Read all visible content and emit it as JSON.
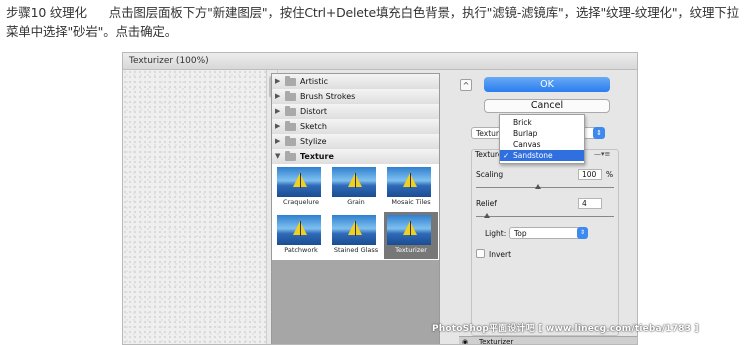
{
  "instruction": {
    "step": "步骤10 纹理化",
    "text": "点击图层面板下方\"新建图层\"，按住Ctrl+Delete填充白色背景，执行\"滤镜-滤镜库\"，选择\"纹理-纹理化\"，纹理下拉菜单中选择\"砂岩\"。点击确定。"
  },
  "window": {
    "title": "Texturizer (100%)"
  },
  "categories": [
    {
      "label": "Artistic",
      "expanded": false
    },
    {
      "label": "Brush Strokes",
      "expanded": false
    },
    {
      "label": "Distort",
      "expanded": false
    },
    {
      "label": "Sketch",
      "expanded": false
    },
    {
      "label": "Stylize",
      "expanded": false
    },
    {
      "label": "Texture",
      "expanded": true
    }
  ],
  "filters": [
    {
      "label": "Craquelure",
      "selected": false
    },
    {
      "label": "Grain",
      "selected": false
    },
    {
      "label": "Mosaic Tiles",
      "selected": false
    },
    {
      "label": "Patchwork",
      "selected": false
    },
    {
      "label": "Stained Glass",
      "selected": false
    },
    {
      "label": "Texturizer",
      "selected": true
    }
  ],
  "buttons": {
    "ok": "OK",
    "cancel": "Cancel",
    "collapse_symbol": "^"
  },
  "filter_select": {
    "value": "Texturizer"
  },
  "texture_dropdown": {
    "options": [
      "Brick",
      "Burlap",
      "Canvas",
      "Sandstone"
    ],
    "selected": "Sandstone",
    "check": "✓"
  },
  "settings": {
    "texture_label": "Texture",
    "scaling_label": "Scaling",
    "scaling_value": "100",
    "scaling_unit": "%",
    "scaling_level": 0.45,
    "relief_label": "Relief",
    "relief_value": "4",
    "relief_level": 0.08,
    "light_label": "Light:",
    "light_value": "Top",
    "invert_label": "Invert",
    "invert_checked": false
  },
  "layers": [
    {
      "name": "Texturizer",
      "visible": true
    }
  ],
  "watermark": "PhotoShop平面设计吧 [ www.linecg.com/tieba/1783 ]",
  "colors": {
    "accent": "#2f6fe0",
    "ok_button": "#2a7ef0",
    "selected_filter": "#777777"
  },
  "icons": {
    "expand": "triangle-right-icon",
    "collapse": "triangle-down-icon",
    "folder": "folder-icon",
    "eye": "eye-icon",
    "menu": "panel-menu-icon"
  }
}
